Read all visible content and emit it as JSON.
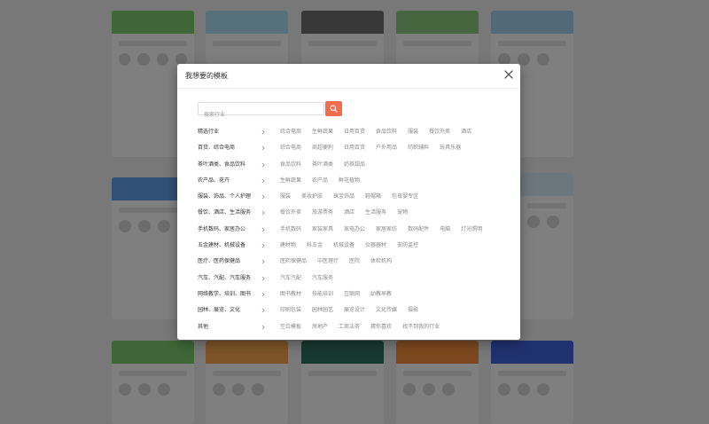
{
  "modal": {
    "title": "我想要的模板",
    "search_placeholder": "搜索行业"
  },
  "categories": [
    {
      "name": "精选行业",
      "tags": [
        "综合电商",
        "生鲜蔬果",
        "日用百货",
        "食品饮料",
        "服装",
        "餐饮外卖",
        "酒店"
      ]
    },
    {
      "name": "百货、综合电商",
      "tags": [
        "综合电商",
        "商超便利",
        "日用百货",
        "户外用品",
        "纺织辅料",
        "玩具乐器"
      ]
    },
    {
      "name": "茶叶酒类、食品饮料",
      "tags": [
        "食品饮料",
        "茶叶酒类",
        "奶茶甜品"
      ]
    },
    {
      "name": "农产品、花卉",
      "tags": [
        "生鲜蔬果",
        "农产品",
        "鲜花植物"
      ]
    },
    {
      "name": "服装、饰品、个人护理",
      "tags": [
        "服装",
        "美妆护肤",
        "珠宝饰品",
        "鞋帽箱",
        "包母婴专区"
      ]
    },
    {
      "name": "餐饮、酒店、生活服务",
      "tags": [
        "餐饮外卖",
        "旅游票务",
        "酒店",
        "生活服务",
        "宠物"
      ]
    },
    {
      "name": "手机数码、家居办公",
      "tags": [
        "手机数码",
        "家装家具",
        "家电办公",
        "家居家纺",
        "数码配件",
        "电脑",
        "灯光照明"
      ]
    },
    {
      "name": "五金建材、机械设备",
      "tags": [
        "建材物",
        "科五金",
        "机械设备",
        "仪器器材",
        "安防监控"
      ]
    },
    {
      "name": "医疗、医药保健品",
      "tags": [
        "医药保健品",
        "中医理疗",
        "医院",
        "体检机构"
      ]
    },
    {
      "name": "汽车、汽配、汽车服务",
      "tags": [
        "汽车汽配",
        "汽车服务"
      ]
    },
    {
      "name": "网络教学、培训、图书",
      "tags": [
        "图书教材",
        "技能培训",
        "互联网",
        "幼教早教"
      ]
    },
    {
      "name": "园林、展览、文化",
      "tags": [
        "印刷包装",
        "园林园艺",
        "展览设计",
        "文化传媒",
        "摄影"
      ]
    },
    {
      "name": "其他",
      "tags": [
        "空白模板",
        "房地产",
        "工商法务",
        "猜你喜欢",
        "找不到我的行业"
      ]
    }
  ],
  "colors": {
    "accent": "#f26d4d",
    "overlay": "rgba(0,0,0,0.48)"
  }
}
